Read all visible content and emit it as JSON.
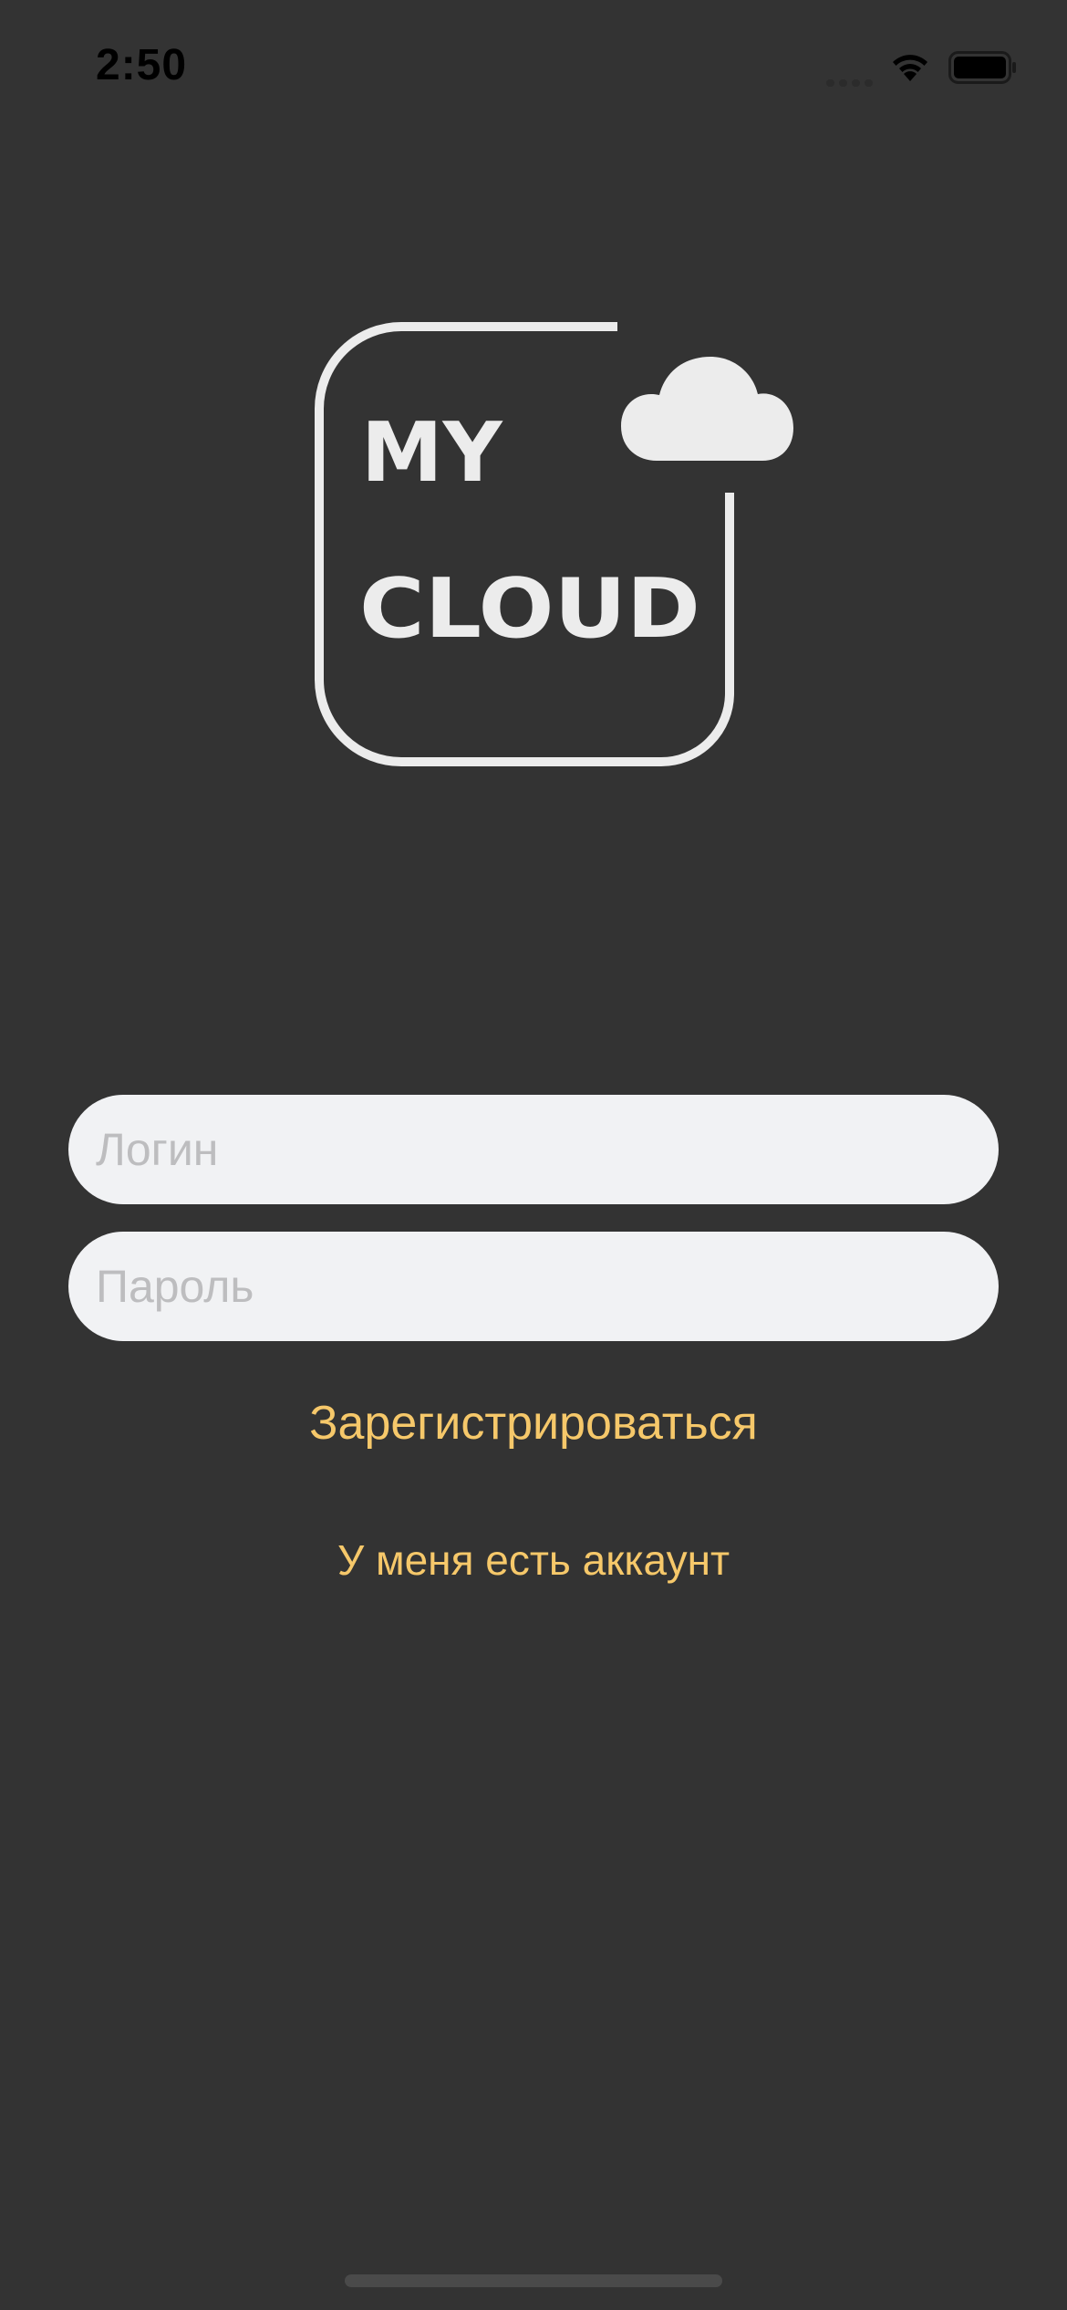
{
  "status_bar": {
    "time": "2:50",
    "icons": [
      "cellular-signal-icon",
      "wifi-icon",
      "battery-icon"
    ]
  },
  "logo": {
    "line1": "MY",
    "line2": "CLOUD",
    "icon": "cloud-icon"
  },
  "form": {
    "login_placeholder": "Логин",
    "login_value": "",
    "password_placeholder": "Пароль",
    "password_value": "",
    "register_label": "Зарегистрироваться",
    "have_account_label": "У меня есть аккаунт"
  },
  "colors": {
    "background": "#333333",
    "field_background": "#f1f2f4",
    "placeholder": "#bdbdbf",
    "accent": "#f6c86a",
    "logo": "#ececec"
  }
}
